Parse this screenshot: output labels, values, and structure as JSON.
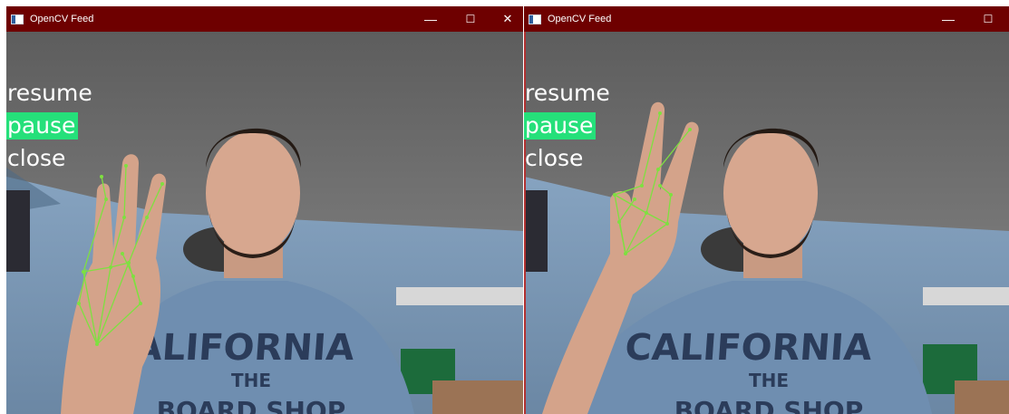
{
  "windows": [
    {
      "title": "OpenCV Feed",
      "controls": {
        "minimize": "—",
        "maximize": "☐",
        "close": "✕"
      },
      "menu": [
        "resume",
        "pause",
        "close"
      ],
      "active_menu_index": 1,
      "gesture": "three-fingers"
    },
    {
      "title": "OpenCV Feed",
      "controls": {
        "minimize": "—",
        "maximize": "☐"
      },
      "menu": [
        "resume",
        "pause",
        "close"
      ],
      "active_menu_index": 1,
      "gesture": "two-fingers"
    }
  ],
  "shirt": {
    "line1": "CALIFORNIA",
    "line2": "THE",
    "line3": "BOARD SHOP"
  },
  "colors": {
    "titlebar": "#6e0000",
    "highlight": "#25e07a",
    "landmarks": "#7ee040",
    "wall": "#7c98b4",
    "ceiling": "#6b6b6b"
  }
}
